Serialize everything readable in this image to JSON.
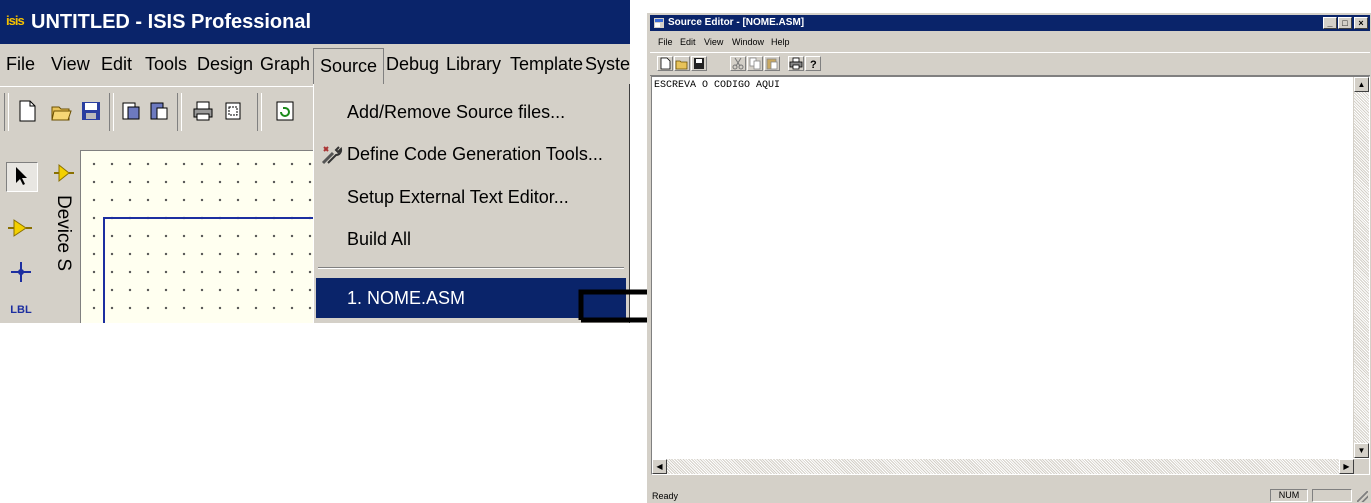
{
  "isis": {
    "logo": "isis",
    "title": "UNTITLED - ISIS Professional",
    "menu": [
      "File",
      "View",
      "Edit",
      "Tools",
      "Design",
      "Graph",
      "Source",
      "Debug",
      "Library",
      "Template",
      "Syster"
    ],
    "active_menu": "Source",
    "device_selector_label": "Device S",
    "tool_label_lbl": "LBL",
    "source_menu": {
      "item1": "Add/Remove Source files...",
      "item2": "Define Code Generation Tools...",
      "item3": "Setup External Text Editor...",
      "item4": "Build All",
      "item5": "1. NOME.ASM"
    }
  },
  "editor": {
    "title": "Source Editor - [NOME.ASM]",
    "menu": [
      "File",
      "Edit",
      "View",
      "Window",
      "Help"
    ],
    "content": "ESCREVA O CODIGO AQUI",
    "status_ready": "Ready",
    "status_num": "NUM"
  },
  "colors": {
    "titlebar": "#0a246a",
    "chrome": "#d4d0c8",
    "highlight": "#0a246a"
  }
}
